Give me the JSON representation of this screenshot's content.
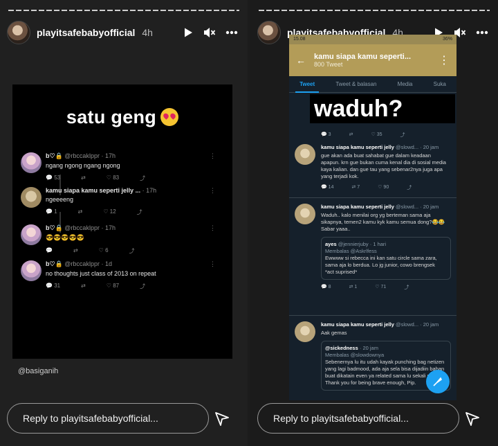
{
  "stories": [
    {
      "username": "playitsafebabyofficial",
      "time": "4h",
      "reply_placeholder": "Reply to playitsafebabyofficial...",
      "card": {
        "title": "satu geng",
        "tweets": [
          {
            "name": "b♡🔒",
            "handle": "@rbccaklppr · 17h",
            "text": "ngang ngong ngang ngong",
            "counts": [
              "53",
              "",
              "83",
              ""
            ]
          },
          {
            "name": "kamu siapa kamu seperti jelly ...",
            "handle": "· 17h",
            "text": "ngeeeeng",
            "counts": [
              "1",
              "",
              "12",
              ""
            ]
          },
          {
            "name": "b♡🔒",
            "handle": "@rbccaklppr · 17h",
            "text": "😎😎😎😎😎",
            "counts": [
              "",
              "",
              "6",
              ""
            ]
          },
          {
            "name": "b♡🔒",
            "handle": "@rbccaklppr · 1d",
            "text": "no thoughts just class of 2013 on repeat",
            "counts": [
              "31",
              "",
              "87",
              ""
            ]
          }
        ]
      },
      "credit": "@basiganih"
    },
    {
      "username": "playitsafebabyofficial",
      "time": "4h",
      "reply_placeholder": "Reply to playitsafebabyofficial...",
      "phone": {
        "status_time": "15.08",
        "status_right": "36%",
        "title": "kamu siapa kamu seperti...",
        "subtitle": "800 Tweet",
        "tabs": [
          "Tweet",
          "Tweet & balasan",
          "Media",
          "Suka"
        ],
        "overlay_text": "waduh?",
        "top_counts": [
          "3",
          "",
          "35",
          ""
        ],
        "tweets": [
          {
            "name": "kamu siapa kamu seperti jelly",
            "handle": "@slowd... · 20 jam",
            "text": "gue akan ada buat sahabat gue dalam keadaan apapun. krn gue bukan cuma kenal dia di sosial media kaya kalian. dan gue tau yang sebenar2nya juga apa yang terjadi kok.",
            "counts": [
              "14",
              "7",
              "90",
              ""
            ]
          },
          {
            "name": "kamu siapa kamu seperti jelly",
            "handle": "@slowd... · 20 jam",
            "text": "Waduh.. kalo menilai org yg berteman sama aja sikapnya, temen2 kamu kyk kamu semua dong?😂😂 Sabar yaaa..",
            "counts": [
              "8",
              "1",
              "71",
              ""
            ],
            "quote": {
              "name": "ayes",
              "handle": "@jennierjuby · 1 hari",
              "reply_to": "Membalas @Askrlfess",
              "text": "Ewwww si rebecca ini kan satu circle sama zara, sama aja lo berdua. Lo jg junior, cowo brengsek",
              "extra": "*act suprised*"
            }
          },
          {
            "name": "kamu siapa kamu seperti jelly",
            "handle": "@slowd... · 20 jam",
            "text": "Aak gemas",
            "quote": {
              "name": "@sickedness",
              "handle": "· 20 jam",
              "reply_to": "Membalas @slowdownya",
              "text": "Sebenernya lu itu udah kayak punching bag netizen yang lagi badmood, ada aja sela bisa dijadiin bahan buat dikatain even ya related sama lu sekali pun. Thank you for being brave enough, Pip."
            }
          }
        ]
      }
    }
  ]
}
